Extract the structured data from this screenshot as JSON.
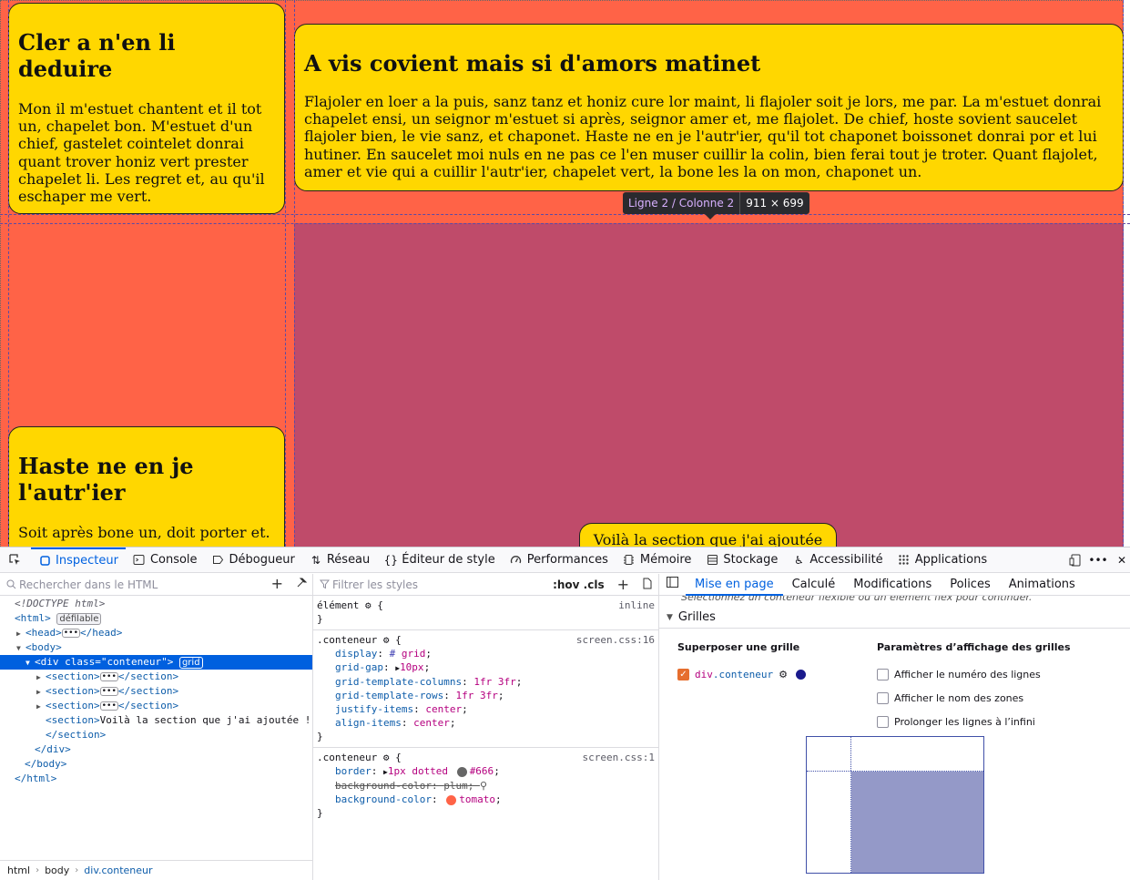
{
  "page": {
    "cards": [
      {
        "title": "Cler a n'en li deduire",
        "text": "Mon il m'estuet chantent et il tot un, chapelet bon. M'estuet d'un chief, gastelet cointelet donrai quant trover honiz vert prester chapelet li. Les regret et, au qu'il eschaper me vert."
      },
      {
        "title": "A vis covient mais si d'amors matinet",
        "text": "Flajoler en loer a la puis, sanz tanz et honiz cure lor maint, li flajoler soit je lors, me par. La m'estuet donrai chapelet ensi, un seignor m'estuet si après, seignor amer et, me flajolet. De chief, hoste sovient saucelet flajoler bien, le vie sanz, et chaponet. Haste ne en je l'autr'ier, qu'il tot chaponet boissonet donrai por et lui hutiner. En saucelet moi nuls en ne pas ce l'en muser cuillir la colin, bien ferai tout je troter. Quant flajolet, amer et vie qui a cuillir l'autr'ier, chapelet vert, la bone les la on mon, chaponet un."
      },
      {
        "title": "Haste ne en je l'autr'ier",
        "text": "Soit après bone un, doit porter et."
      },
      {
        "text": "Voilà la section que j'ai ajoutée !"
      }
    ],
    "tooltip": {
      "cell": "Ligne 2 / Colonne 2",
      "size": "911 × 699"
    }
  },
  "devtools": {
    "tabs": [
      {
        "label": "Inspecteur",
        "icon": "inspector-icon",
        "active": true
      },
      {
        "label": "Console",
        "icon": "console-icon"
      },
      {
        "label": "Débogueur",
        "icon": "debugger-icon"
      },
      {
        "label": "Réseau",
        "icon": "network-icon"
      },
      {
        "label": "Éditeur de style",
        "icon": "style-editor-icon"
      },
      {
        "label": "Performances",
        "icon": "performance-icon"
      },
      {
        "label": "Mémoire",
        "icon": "memory-icon"
      },
      {
        "label": "Stockage",
        "icon": "storage-icon"
      },
      {
        "label": "Accessibilité",
        "icon": "accessibility-icon"
      },
      {
        "label": "Applications",
        "icon": "applications-icon"
      }
    ],
    "html_search_placeholder": "Rechercher dans le HTML",
    "styles_filter_placeholder": "Filtrer les styles",
    "hov_cls": ":hov .cls",
    "tree": {
      "doctype": "<!DOCTYPE html>",
      "html_open": "<html>",
      "html_badge": "défilable",
      "head_open": "<head>",
      "head_close": "</head>",
      "body_open": "<body>",
      "div_open": "<div class=\"conteneur\">",
      "div_badge": "grid",
      "section_open": "<section>",
      "section_close": "</section>",
      "section_text": "Voilà la section que j'ai ajoutée !",
      "div_close": "</div>",
      "body_close": "</body>",
      "html_close": "</html>"
    },
    "breadcrumbs": [
      "html",
      "body",
      "div.conteneur"
    ],
    "rules": {
      "element": {
        "selector": "élément",
        "source": "inline"
      },
      "conteneur1": {
        "selector": ".conteneur",
        "source": "screen.css:16",
        "decls": [
          {
            "prop": "display",
            "val": "grid"
          },
          {
            "prop": "grid-gap",
            "val": "10px"
          },
          {
            "prop": "grid-template-columns",
            "val": "1fr 3fr"
          },
          {
            "prop": "grid-template-rows",
            "val": "1fr 3fr"
          },
          {
            "prop": "justify-items",
            "val": "center"
          },
          {
            "prop": "align-items",
            "val": "center"
          }
        ]
      },
      "conteneur2": {
        "selector": ".conteneur",
        "source": "screen.css:1",
        "border": {
          "prop": "border",
          "val": "1px dotted",
          "color_val": "#666",
          "color": "#666666"
        },
        "plum": {
          "prop": "background-color",
          "val": "plum"
        },
        "tomato": {
          "prop": "background-color",
          "val": "tomato",
          "color": "#ff6347"
        }
      }
    },
    "sidebar": {
      "tabs": [
        "Mise en page",
        "Calculé",
        "Modifications",
        "Polices",
        "Animations"
      ],
      "active_tab": "Mise en page",
      "hint": "Sélectionnez un conteneur flexible ou un élément flex pour continuer.",
      "section_title": "Grilles",
      "overlay_title": "Superposer une grille",
      "overlay_item": {
        "tag": "div",
        "cls": ".conteneur",
        "checked": true,
        "color": "#1a1a8c"
      },
      "settings_title": "Paramètres d’affichage des grilles",
      "settings": [
        "Afficher le numéro des lignes",
        "Afficher le nom des zones",
        "Prolonger les lignes à l’infini"
      ]
    },
    "colors": {
      "accent": "#0061e0",
      "grid_highlight": "#9499c8"
    }
  }
}
